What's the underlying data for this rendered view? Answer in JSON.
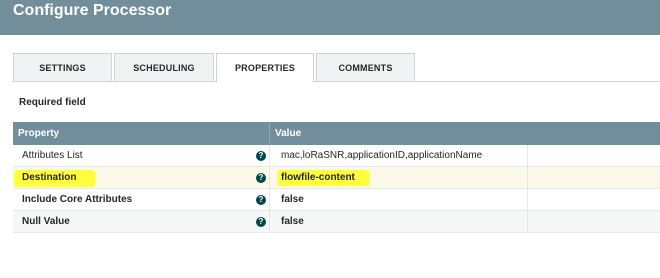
{
  "dialog": {
    "title": "Configure Processor"
  },
  "tabs": [
    {
      "label": "SETTINGS",
      "active": false
    },
    {
      "label": "SCHEDULING",
      "active": false
    },
    {
      "label": "PROPERTIES",
      "active": true
    },
    {
      "label": "COMMENTS",
      "active": false
    }
  ],
  "properties": {
    "required_note": "Required field",
    "columns": {
      "property": "Property",
      "value": "Value"
    },
    "help_glyph": "?",
    "rows": [
      {
        "name": "Attributes List",
        "value": "mac,loRaSNR,applicationID,applicationName",
        "required": false
      },
      {
        "name": "Destination",
        "value": "flowfile-content",
        "required": true,
        "highlighted": true
      },
      {
        "name": "Include Core Attributes",
        "value": "false",
        "required": true
      },
      {
        "name": "Null Value",
        "value": "false",
        "required": true
      }
    ]
  },
  "colors": {
    "header_bg": "#728e9b",
    "help_icon": "#004849",
    "highlighter": "#ffff2e"
  }
}
